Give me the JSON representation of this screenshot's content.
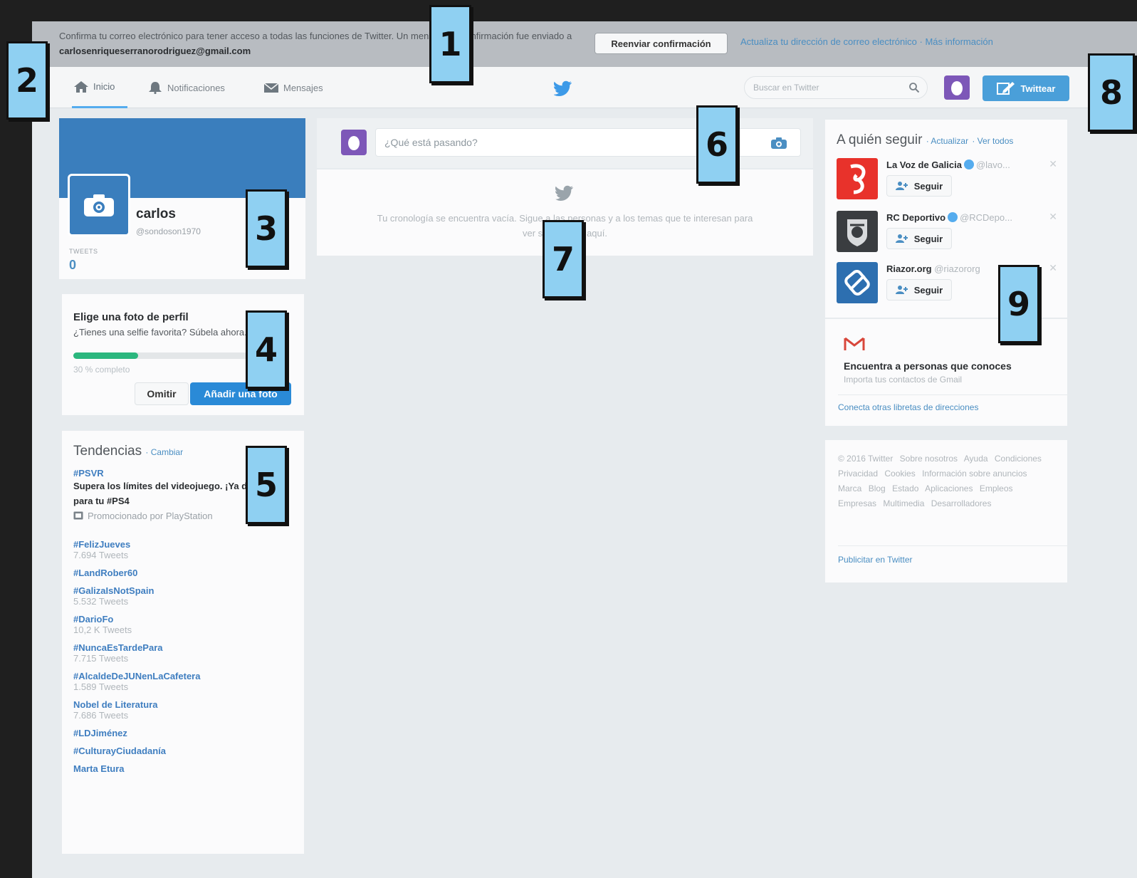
{
  "banner": {
    "message_pre": "Confirma tu correo electrónico para tener acceso a todas las funciones de Twitter. Un mensaje de confirmación fue enviado a ",
    "email": "carlosenriqueserranorodriguez@gmail.com",
    "resend_label": "Reenviar confirmación",
    "update_link": "Actualiza tu dirección de correo electrónico",
    "separator": "·",
    "more_link": "Más información"
  },
  "nav": {
    "home": "Inicio",
    "notifications": "Notificaciones",
    "messages": "Mensajes",
    "search_placeholder": "Buscar en Twitter",
    "tweet_button": "Twittear"
  },
  "profile": {
    "name": "carlos",
    "handle": "@sondoson1970",
    "tweets_label": "TWEETS",
    "tweets_count": "0"
  },
  "photo_prompt": {
    "title": "Elige una foto de perfil",
    "subtitle": "¿Tienes una selfie favorita? Súbela ahora.",
    "progress_fraction": 0.3,
    "progress_text": "30 % completo",
    "skip_label": "Omitir",
    "add_label": "Añadir una foto"
  },
  "trends": {
    "title": "Tendencias",
    "change_link": "· Cambiar",
    "promoted": {
      "tag": "#PSVR",
      "description": "Supera los límites del videojuego. ¡Ya disponible para tu #PS4",
      "note": "Promocionado por PlayStation"
    },
    "items": [
      {
        "tag": "#FelizJueves",
        "count": "7.694 Tweets"
      },
      {
        "tag": "#LandRober60",
        "count": ""
      },
      {
        "tag": "#GalizaIsNotSpain",
        "count": "5.532 Tweets"
      },
      {
        "tag": "#DarioFo",
        "count": "10,2 K Tweets"
      },
      {
        "tag": "#NuncaEsTardePara",
        "count": "7.715 Tweets"
      },
      {
        "tag": "#AlcaldeDeJUNenLaCafetera",
        "count": "1.589 Tweets"
      },
      {
        "tag": "Nobel de Literatura",
        "count": "7.686 Tweets"
      },
      {
        "tag": "#LDJiménez",
        "count": ""
      },
      {
        "tag": "#CulturayCiudadanía",
        "count": ""
      },
      {
        "tag": "Marta Etura",
        "count": ""
      }
    ]
  },
  "composer": {
    "placeholder": "¿Qué está pasando?"
  },
  "timeline": {
    "empty_text": "Tu cronología se encuentra vacía. Sigue a las personas y a los temas que te interesan para ver sus Tweets aquí."
  },
  "who_to_follow": {
    "title": "A quién seguir",
    "refresh_link": "· Actualizar",
    "view_all_link": "· Ver todos",
    "follow_label": "Seguir",
    "accounts": [
      {
        "name": "La Voz de Galicia",
        "handle": "@lavo...",
        "color": "#e8322b"
      },
      {
        "name": "RC Deportivo",
        "handle": "@RCDepo...",
        "color": "#3a3d40"
      },
      {
        "name": "Riazor.org",
        "handle": "@riazororg",
        "color": "#2d6fb0"
      }
    ]
  },
  "gmail": {
    "title": "Encuentra a personas que conoces",
    "subtitle": "Importa tus contactos de Gmail",
    "link": "Conecta otras libretas de direcciones"
  },
  "footer": {
    "links": [
      "© 2016 Twitter",
      "Sobre nosotros",
      "Ayuda",
      "Condiciones",
      "Privacidad",
      "Cookies",
      "Información sobre anuncios",
      "Marca",
      "Blog",
      "Estado",
      "Aplicaciones",
      "Empleos",
      "Empresas",
      "Multimedia",
      "Desarrolladores"
    ],
    "advertise": "Publicitar en Twitter"
  },
  "callouts": [
    "1",
    "2",
    "3",
    "4",
    "5",
    "6",
    "7",
    "8",
    "9"
  ],
  "colors": {
    "twitter_blue": "#55acee",
    "cover_blue": "#3a7ebd",
    "callout_blue": "#8fd0f2",
    "progress_green": "#2bb77e",
    "avatar_purple": "#7d57b8"
  }
}
